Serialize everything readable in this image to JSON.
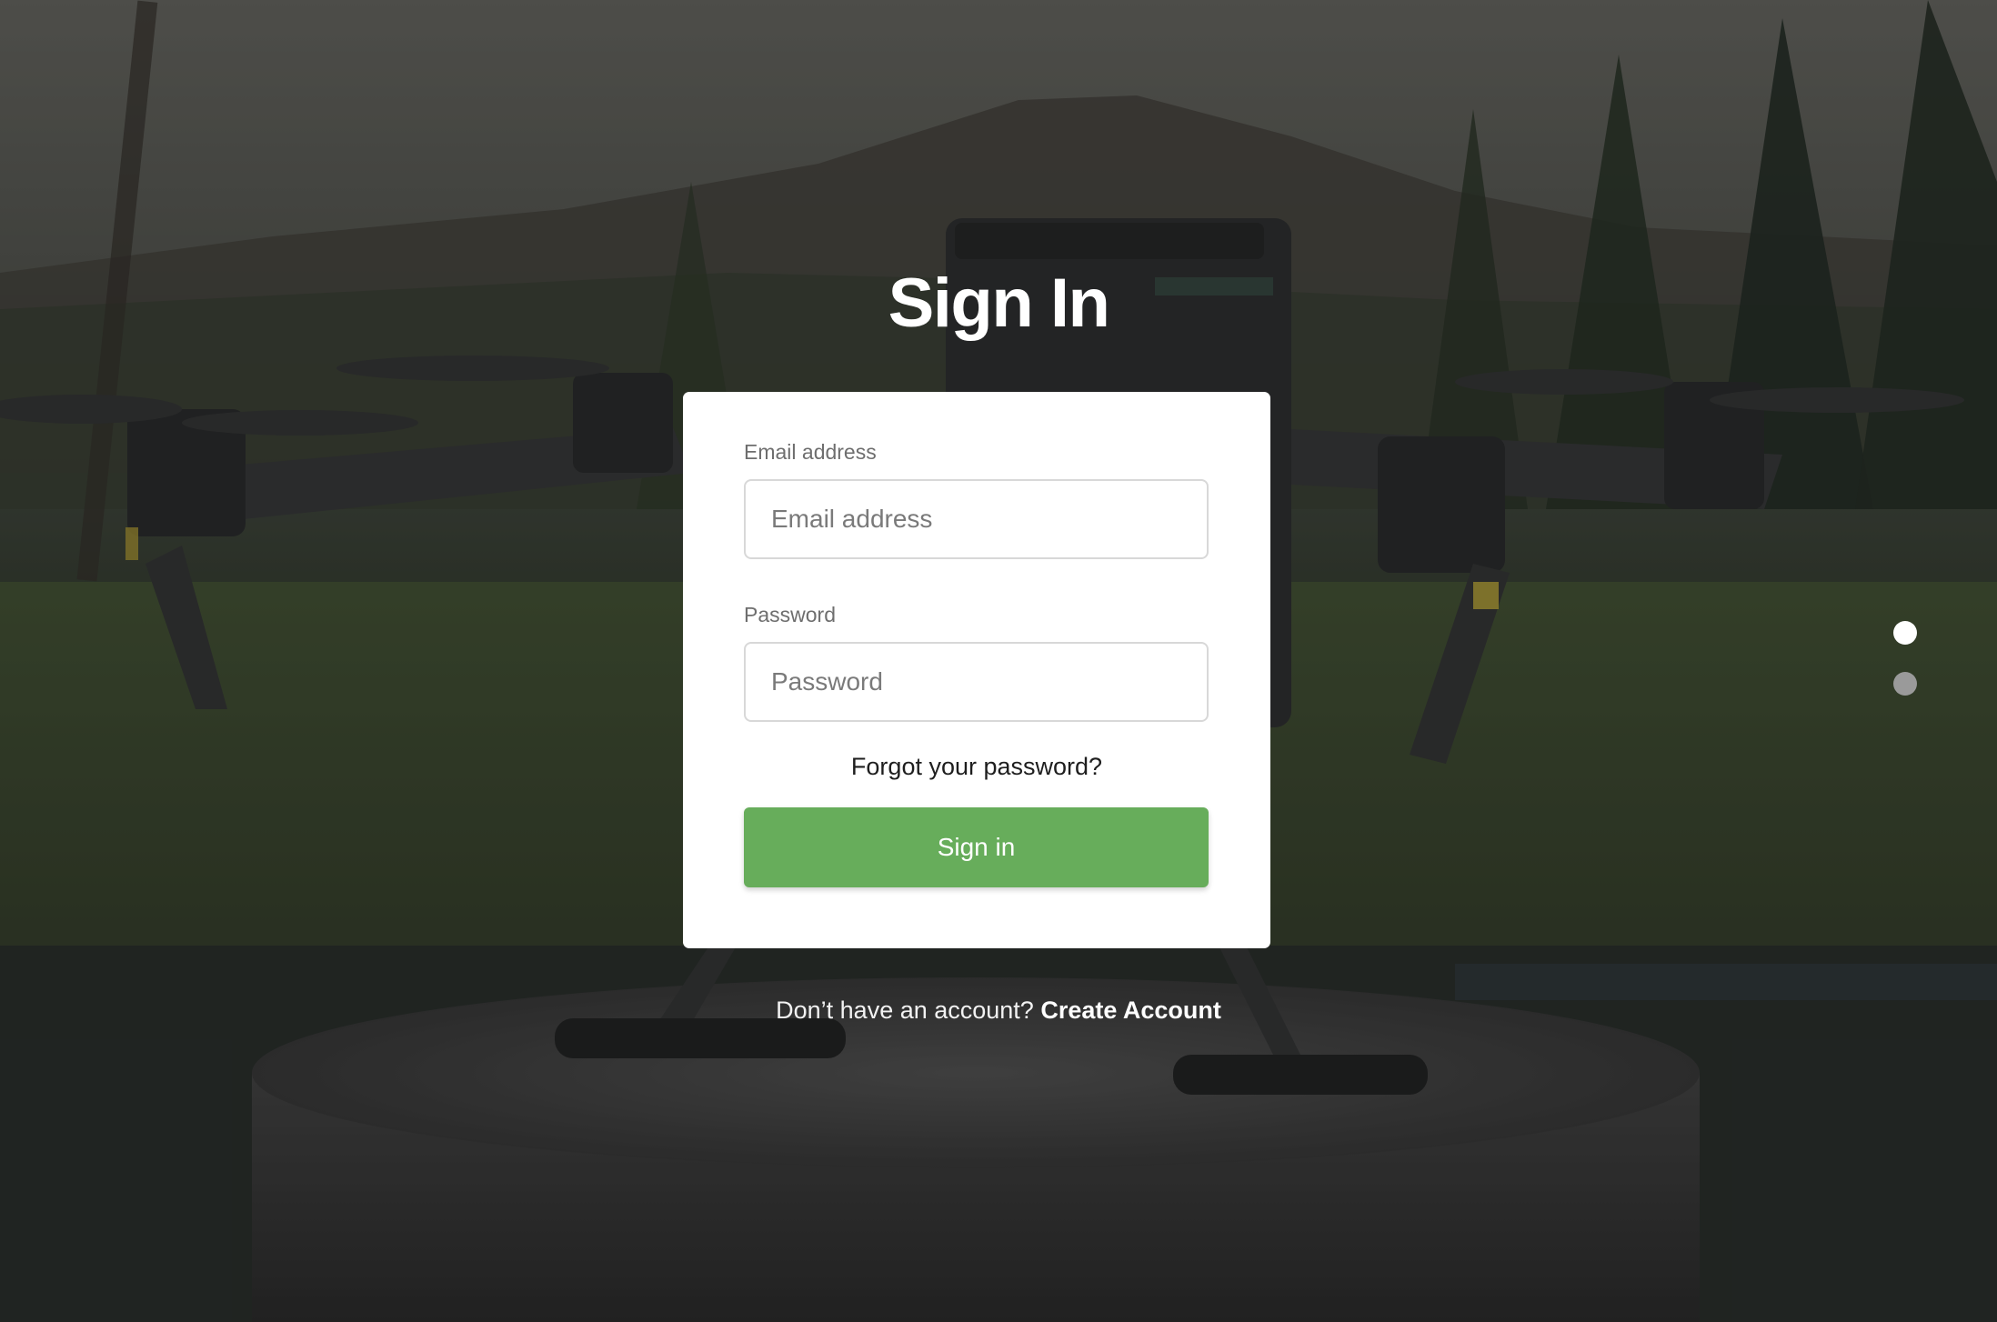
{
  "page": {
    "title": "Sign In"
  },
  "form": {
    "email_label": "Email address",
    "email_value": "",
    "email_placeholder": "Email address",
    "password_label": "Password",
    "password_value": "",
    "password_placeholder": "Password",
    "forgot_link": "Forgot your password?",
    "submit_label": "Sign in"
  },
  "footer": {
    "prompt": "Don’t have an account? ",
    "create_link": "Create Account"
  },
  "carousel": {
    "slide_count": 2,
    "active_slide": 1
  },
  "colors": {
    "primary_button": "#67ad5b",
    "card_background": "#ffffff"
  },
  "background": {
    "subject": "quadcopter drone on pedestal, outdoor dusk scene"
  }
}
